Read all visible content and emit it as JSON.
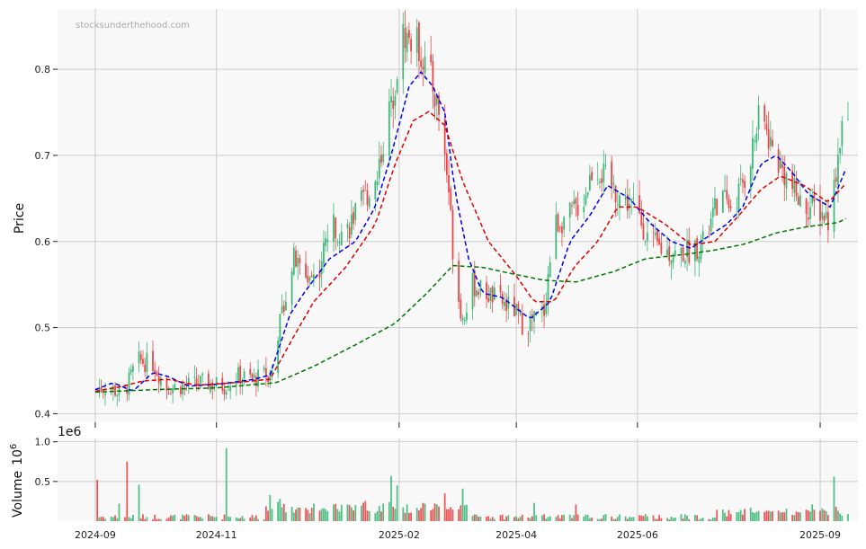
{
  "watermark": "stocksunderthehood.com",
  "chart_data": [
    {
      "type": "candlestick",
      "ylabel": "Price",
      "ylim": [
        0.39,
        0.87
      ],
      "yticks": [
        "0.4",
        "0.5",
        "0.6",
        "0.7",
        "0.8"
      ],
      "xlim": [
        "2024-08-13",
        "2025-09-20"
      ],
      "xticks": [
        "2024-09",
        "2024-11",
        "2025-02",
        "2025-04",
        "2025-06",
        "2025-09"
      ],
      "grid": true,
      "colors": {
        "up": "#3cb878",
        "down": "#e84545"
      },
      "close_waypoints": [
        [
          "2024-09-01",
          0.428
        ],
        [
          "2024-09-08",
          0.432
        ],
        [
          "2024-09-15",
          0.42
        ],
        [
          "2024-09-22",
          0.462
        ],
        [
          "2024-09-30",
          0.458
        ],
        [
          "2024-10-07",
          0.43
        ],
        [
          "2024-10-15",
          0.432
        ],
        [
          "2024-10-25",
          0.436
        ],
        [
          "2024-11-05",
          0.432
        ],
        [
          "2024-11-12",
          0.444
        ],
        [
          "2024-11-20",
          0.44
        ],
        [
          "2024-11-28",
          0.448
        ],
        [
          "2024-12-05",
          0.53
        ],
        [
          "2024-12-10",
          0.58
        ],
        [
          "2024-12-15",
          0.56
        ],
        [
          "2024-12-22",
          0.56
        ],
        [
          "2024-12-28",
          0.62
        ],
        [
          "2025-01-05",
          0.61
        ],
        [
          "2025-01-12",
          0.64
        ],
        [
          "2025-01-20",
          0.67
        ],
        [
          "2025-01-28",
          0.76
        ],
        [
          "2025-02-03",
          0.84
        ],
        [
          "2025-02-10",
          0.83
        ],
        [
          "2025-02-17",
          0.79
        ],
        [
          "2025-02-22",
          0.74
        ],
        [
          "2025-02-26",
          0.66
        ],
        [
          "2025-03-01",
          0.56
        ],
        [
          "2025-03-05",
          0.51
        ],
        [
          "2025-03-10",
          0.55
        ],
        [
          "2025-03-17",
          0.54
        ],
        [
          "2025-03-24",
          0.53
        ],
        [
          "2025-03-31",
          0.52
        ],
        [
          "2025-04-05",
          0.5
        ],
        [
          "2025-04-10",
          0.51
        ],
        [
          "2025-04-15",
          0.52
        ],
        [
          "2025-04-20",
          0.62
        ],
        [
          "2025-04-28",
          0.63
        ],
        [
          "2025-05-05",
          0.65
        ],
        [
          "2025-05-10",
          0.69
        ],
        [
          "2025-05-17",
          0.67
        ],
        [
          "2025-05-24",
          0.65
        ],
        [
          "2025-05-31",
          0.64
        ],
        [
          "2025-06-07",
          0.6
        ],
        [
          "2025-06-14",
          0.59
        ],
        [
          "2025-06-21",
          0.585
        ],
        [
          "2025-06-28",
          0.59
        ],
        [
          "2025-07-05",
          0.6
        ],
        [
          "2025-07-12",
          0.65
        ],
        [
          "2025-07-19",
          0.64
        ],
        [
          "2025-07-26",
          0.68
        ],
        [
          "2025-08-02",
          0.75
        ],
        [
          "2025-08-09",
          0.7
        ],
        [
          "2025-08-16",
          0.67
        ],
        [
          "2025-08-23",
          0.64
        ],
        [
          "2025-08-30",
          0.64
        ],
        [
          "2025-09-06",
          0.625
        ],
        [
          "2025-09-12",
          0.74
        ],
        [
          "2025-09-15",
          0.73
        ]
      ],
      "moving_averages": [
        {
          "color": "#0000ee",
          "style": "dashed",
          "waypoints": [
            [
              "2024-09-01",
              0.428
            ],
            [
              "2024-09-10",
              0.436
            ],
            [
              "2024-09-20",
              0.426
            ],
            [
              "2024-09-30",
              0.448
            ],
            [
              "2024-10-08",
              0.443
            ],
            [
              "2024-10-18",
              0.432
            ],
            [
              "2024-11-05",
              0.435
            ],
            [
              "2024-11-20",
              0.44
            ],
            [
              "2024-11-28",
              0.445
            ],
            [
              "2024-12-08",
              0.515
            ],
            [
              "2024-12-15",
              0.54
            ],
            [
              "2024-12-28",
              0.58
            ],
            [
              "2025-01-10",
              0.6
            ],
            [
              "2025-01-20",
              0.64
            ],
            [
              "2025-01-28",
              0.7
            ],
            [
              "2025-02-06",
              0.78
            ],
            [
              "2025-02-12",
              0.797
            ],
            [
              "2025-02-18",
              0.78
            ],
            [
              "2025-02-24",
              0.75
            ],
            [
              "2025-03-01",
              0.66
            ],
            [
              "2025-03-08",
              0.58
            ],
            [
              "2025-03-15",
              0.54
            ],
            [
              "2025-03-25",
              0.535
            ],
            [
              "2025-04-08",
              0.51
            ],
            [
              "2025-04-18",
              0.53
            ],
            [
              "2025-04-28",
              0.6
            ],
            [
              "2025-05-08",
              0.63
            ],
            [
              "2025-05-17",
              0.665
            ],
            [
              "2025-05-28",
              0.65
            ],
            [
              "2025-06-08",
              0.62
            ],
            [
              "2025-06-18",
              0.6
            ],
            [
              "2025-06-28",
              0.592
            ],
            [
              "2025-07-06",
              0.605
            ],
            [
              "2025-07-16",
              0.62
            ],
            [
              "2025-07-24",
              0.64
            ],
            [
              "2025-08-02",
              0.69
            ],
            [
              "2025-08-10",
              0.7
            ],
            [
              "2025-08-18",
              0.68
            ],
            [
              "2025-08-26",
              0.655
            ],
            [
              "2025-09-06",
              0.64
            ],
            [
              "2025-09-15",
              0.69
            ]
          ]
        },
        {
          "color": "#e00000",
          "style": "dashed",
          "waypoints": [
            [
              "2024-09-01",
              0.426
            ],
            [
              "2024-09-15",
              0.432
            ],
            [
              "2024-09-25",
              0.438
            ],
            [
              "2024-10-08",
              0.44
            ],
            [
              "2024-10-22",
              0.433
            ],
            [
              "2024-11-10",
              0.436
            ],
            [
              "2024-11-28",
              0.44
            ],
            [
              "2024-12-10",
              0.49
            ],
            [
              "2024-12-20",
              0.53
            ],
            [
              "2025-01-05",
              0.57
            ],
            [
              "2025-01-20",
              0.62
            ],
            [
              "2025-01-30",
              0.69
            ],
            [
              "2025-02-08",
              0.74
            ],
            [
              "2025-02-16",
              0.751
            ],
            [
              "2025-02-24",
              0.735
            ],
            [
              "2025-03-05",
              0.67
            ],
            [
              "2025-03-18",
              0.6
            ],
            [
              "2025-04-01",
              0.56
            ],
            [
              "2025-04-10",
              0.53
            ],
            [
              "2025-04-20",
              0.53
            ],
            [
              "2025-04-30",
              0.57
            ],
            [
              "2025-05-12",
              0.6
            ],
            [
              "2025-05-22",
              0.64
            ],
            [
              "2025-06-01",
              0.64
            ],
            [
              "2025-06-15",
              0.62
            ],
            [
              "2025-06-28",
              0.596
            ],
            [
              "2025-07-10",
              0.6
            ],
            [
              "2025-07-22",
              0.63
            ],
            [
              "2025-08-02",
              0.66
            ],
            [
              "2025-08-12",
              0.676
            ],
            [
              "2025-08-24",
              0.665
            ],
            [
              "2025-09-05",
              0.645
            ],
            [
              "2025-09-15",
              0.67
            ]
          ]
        },
        {
          "color": "#007700",
          "style": "dashed",
          "waypoints": [
            [
              "2024-09-01",
              0.425
            ],
            [
              "2024-10-01",
              0.428
            ],
            [
              "2024-11-01",
              0.43
            ],
            [
              "2024-12-01",
              0.436
            ],
            [
              "2024-12-20",
              0.455
            ],
            [
              "2025-01-10",
              0.48
            ],
            [
              "2025-01-30",
              0.505
            ],
            [
              "2025-02-15",
              0.54
            ],
            [
              "2025-02-28",
              0.572
            ],
            [
              "2025-03-15",
              0.57
            ],
            [
              "2025-03-31",
              0.562
            ],
            [
              "2025-04-15",
              0.555
            ],
            [
              "2025-05-01",
              0.553
            ],
            [
              "2025-05-20",
              0.565
            ],
            [
              "2025-06-05",
              0.58
            ],
            [
              "2025-06-25",
              0.585
            ],
            [
              "2025-07-10",
              0.59
            ],
            [
              "2025-07-25",
              0.597
            ],
            [
              "2025-08-10",
              0.61
            ],
            [
              "2025-08-25",
              0.617
            ],
            [
              "2025-09-10",
              0.622
            ],
            [
              "2025-09-15",
              0.628
            ]
          ]
        }
      ]
    },
    {
      "type": "bar",
      "ylabel": "Volume",
      "yunit": "1e6",
      "yunit_prefix": "Volume",
      "exponent_text": "10",
      "exponent_power": "6",
      "ylim": [
        0,
        1.0
      ],
      "yticks": [
        "0.5",
        "1.0"
      ],
      "spikes": [
        [
          "2024-09-02",
          0.52
        ],
        [
          "2024-09-13",
          0.22
        ],
        [
          "2024-09-17",
          0.75
        ],
        [
          "2024-09-23",
          0.46
        ],
        [
          "2024-11-06",
          0.92
        ],
        [
          "2024-11-28",
          0.33
        ],
        [
          "2024-12-03",
          0.28
        ],
        [
          "2025-01-28",
          0.57
        ],
        [
          "2025-01-31",
          0.45
        ],
        [
          "2025-02-09",
          0.35
        ],
        [
          "2025-02-24",
          0.35
        ],
        [
          "2025-03-05",
          0.41
        ],
        [
          "2025-04-10",
          0.23
        ],
        [
          "2025-05-01",
          0.21
        ],
        [
          "2025-07-20",
          0.22
        ],
        [
          "2025-08-10",
          0.36
        ],
        [
          "2025-08-28",
          0.21
        ],
        [
          "2025-09-08",
          0.56
        ]
      ]
    }
  ]
}
